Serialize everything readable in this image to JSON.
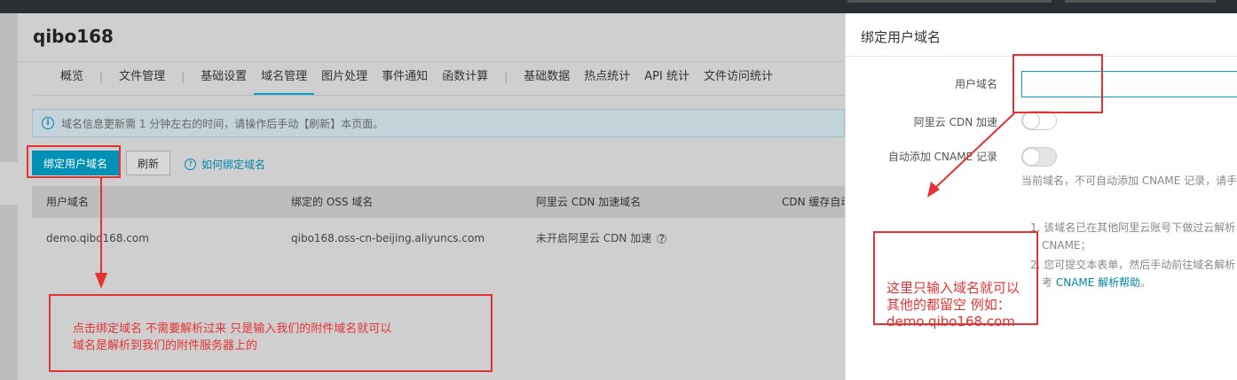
{
  "app": {
    "title": "qibo168"
  },
  "tabs": {
    "items": [
      {
        "label": "概览"
      },
      {
        "label": "文件管理"
      },
      {
        "label": "基础设置"
      },
      {
        "label": "域名管理"
      },
      {
        "label": "图片处理"
      },
      {
        "label": "事件通知"
      },
      {
        "label": "函数计算"
      },
      {
        "label": "基础数据"
      },
      {
        "label": "热点统计"
      },
      {
        "label": "API 统计"
      },
      {
        "label": "文件访问统计"
      }
    ],
    "active": "域名管理"
  },
  "notice": {
    "icon": "info-icon",
    "text": "域名信息更新需 1 分钟左右的时间，请操作后手动【刷新】本页面。"
  },
  "toolbar": {
    "bind_label": "绑定用户域名",
    "refresh_label": "刷新",
    "help_label": "如何绑定域名"
  },
  "table": {
    "headers": [
      "用户域名",
      "绑定的 OSS 域名",
      "阿里云 CDN 加速域名",
      "CDN 缓存自动"
    ],
    "rows": [
      [
        "demo.qibo168.com",
        "qibo168.oss-cn-beijing.aliyuncs.com",
        "未开启阿里云 CDN 加速"
      ]
    ]
  },
  "annotations": {
    "left_line1": "点击绑定域名 不需要解析过来 只是输入我们的附件域名就可以",
    "left_line2": "域名是解析到我们的附件服务器上的",
    "right_line1": "这里只输入域名就可以",
    "right_line2": "其他的都留空 例如：",
    "right_line3": "demo.qibo168.com",
    "color": "#e53333"
  },
  "panel": {
    "title": "绑定用户域名",
    "domain_label": "用户域名",
    "domain_value": "",
    "cdn_label": "阿里云 CDN 加速",
    "cname_label": "自动添加 CNAME 记录",
    "warn": "当前域名，不可自动添加 CNAME 记录，请手",
    "tip1a": "1. 该域名已在其他阿里云账号下做过云解析",
    "tip1b": "CNAME；",
    "tip2a": "2. 您可提交本表单，然后手动前往域名解析",
    "tip2b_prefix": "考",
    "tip2b_link": "CNAME 解析帮助",
    "tip2b_suffix": "。"
  },
  "colors": {
    "accent": "#0090b5",
    "link": "#0086ad",
    "annotation": "#e53333"
  }
}
